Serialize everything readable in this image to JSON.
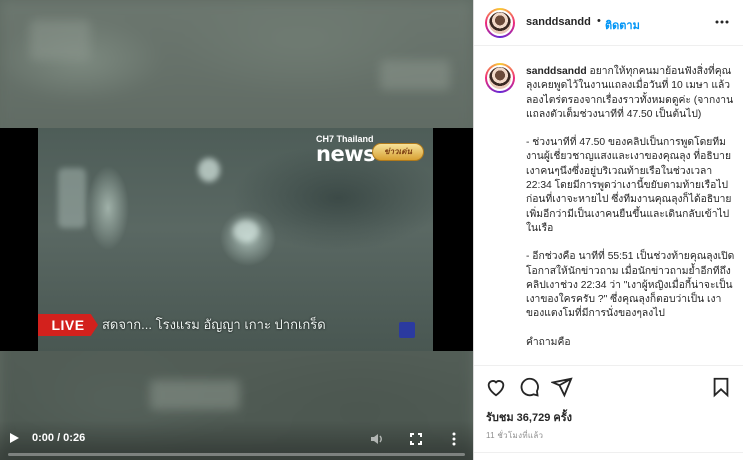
{
  "video": {
    "channel_tag": "CH7 Thailand",
    "channel_name": "news",
    "channel_badge": "ข่าวเด่น",
    "live_label": "LIVE",
    "live_ticker": "สดจาก... โรงแรม อัญญา เกาะ ปากเกร็ด",
    "time_display": "0:00 / 0:26",
    "progress": 0.0
  },
  "header": {
    "username": "sanddsandd",
    "separator": "•",
    "follow_label": "ติดตาม"
  },
  "post": {
    "username": "sanddsandd",
    "caption_intro": "อยากให้ทุกคนมาย้อนฟังสิ่งที่คุณลุงเคยพูดไว้ในงานแถลงเมื่อวันที่ 10 เมษา แล้วลองไตร่ตรองจากเรื่องราวทั้งหมดดูค่ะ (จากงานแถลงตัวเต็มช่วงนาทีที่ 47.50 เป็นต้นไป)",
    "caption_p2": "- ช่วงนาทีที่ 47.50 ของคลิปเป็นการพูดโดยทีมงานผู้เชี่ยวชาญแสงและเงาของคุณลุง ที่อธิบายเงาคนๆนึงซึ่งอยู่บริเวณท้ายเรือในช่วงเวลา 22:34 โดยมีการพูดว่าเงานี้ขยับตามท้ายเรือไปก่อนที่เงาจะหายไป ซึ่งทีมงานคุณลุงก็ได้อธิบายเพิ่มอีกว่ามีเป็นเงาคนยืนขึ้นและเดินกลับเข้าไปในเรือ",
    "caption_p3": "- อีกช่วงคือ นาทีที่ 55:51 เป็นช่วงท้ายคุณลุงเปิดโอกาสให้นักข่าวถาม เมื่อนักข่าวถามย้ำอีกทีถึงคลิปเงาช่วง 22:34 ว่า \"เงาผู้หญิงเมื่อกี้น่าจะเป็นเงาของใครครับ ?\" ซึ่งคุณลุงก็ตอบว่าเป็น เงาของแตงโมที่มีการนั่งของๆลงไป",
    "caption_p4": "คำถามคือ"
  },
  "stats": {
    "views_label": "รับชม",
    "views_count": "36,729 ครั้ง",
    "time_ago": "11 ชั่วโมงที่แล้ว"
  },
  "icons": {
    "play": "play-icon",
    "volume": "volume-icon",
    "fullscreen": "fullscreen-icon",
    "more": "more-vertical-icon",
    "heart": "heart-icon",
    "comment": "comment-icon",
    "share": "share-icon",
    "bookmark": "bookmark-icon",
    "menu": "more-horizontal-icon"
  },
  "colors": {
    "follow": "#0095f6",
    "live": "#d3211d",
    "text": "#262626",
    "muted": "#8e8e8e"
  }
}
